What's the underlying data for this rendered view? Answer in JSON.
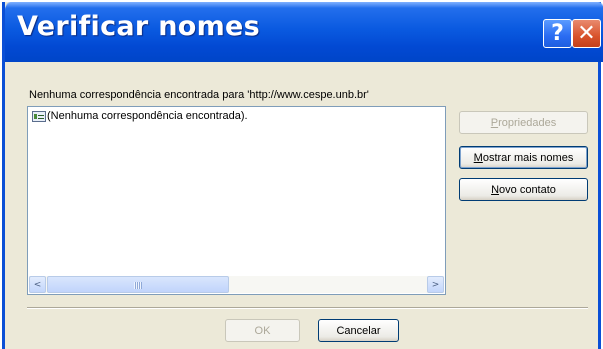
{
  "window": {
    "title": "Verificar nomes",
    "help_label": "?",
    "close_label": "✕"
  },
  "message": "Nenhuma correspondência encontrada para 'http://www.cespe.unb.br'",
  "results": {
    "items": [
      {
        "label": "(Nenhuma correspondência encontrada).",
        "icon": "contact-card-icon"
      }
    ],
    "scroll_left": "<",
    "scroll_right": ">"
  },
  "buttons": {
    "propriedades": {
      "accel": "P",
      "rest": "ropriedades",
      "enabled": false
    },
    "mostrar_mais_nomes": {
      "accel": "M",
      "rest": "ostrar mais nomes",
      "enabled": true
    },
    "novo_contato": {
      "accel": "N",
      "rest": "ovo contato",
      "enabled": true
    },
    "ok": {
      "label": "OK",
      "enabled": false
    },
    "cancelar": {
      "label": "Cancelar",
      "enabled": true
    }
  },
  "colors": {
    "titlebar": "#0a5ae0",
    "dialog_bg": "#ece9d8",
    "close_button": "#d9532c"
  }
}
